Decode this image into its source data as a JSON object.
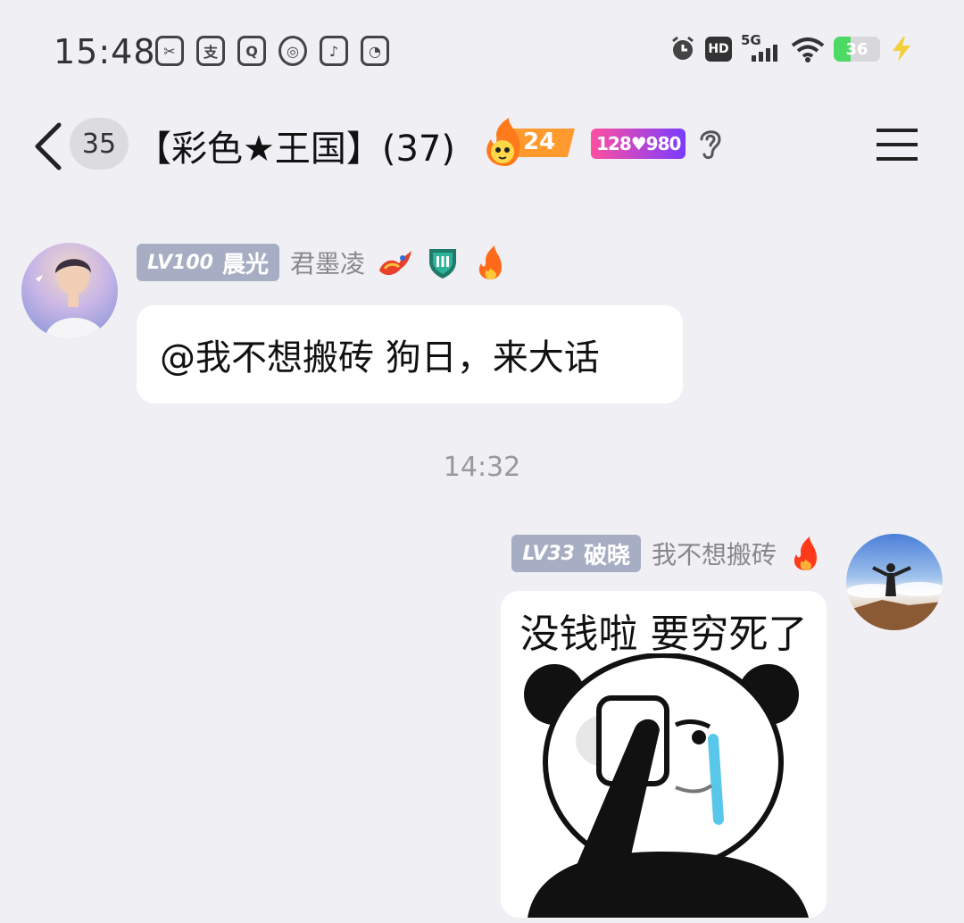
{
  "status_bar": {
    "time": "15:48",
    "app_icons": [
      "scissors-app-icon",
      "pay-app-icon",
      "search-app-icon",
      "planet-app-icon",
      "music-app-icon",
      "browser-app-icon"
    ],
    "network": "5G",
    "hd_label": "HD",
    "battery_level": "36",
    "battery_fraction": 0.36,
    "colors": {
      "battery": "#4cd964",
      "charging": "#f4d03f"
    }
  },
  "header": {
    "unread_count": "35",
    "group_title": "【彩色★王国】(37)",
    "fire_count": "24",
    "group_id_badge": "128♥980"
  },
  "messages": [
    {
      "side": "left",
      "level": "LV100",
      "level_title": "晨光",
      "nickname": "君墨凌",
      "text": "@我不想搬砖 狗日，来大话"
    },
    {
      "timestamp": "14:32"
    },
    {
      "side": "right",
      "level": "LV33",
      "level_title": "破晓",
      "nickname": "我不想搬砖",
      "meme_caption": "没钱啦 要穷死了"
    }
  ],
  "colors": {
    "background": "#f0eff4",
    "bubble": "#ffffff",
    "level_tag": "#a7aec3"
  }
}
